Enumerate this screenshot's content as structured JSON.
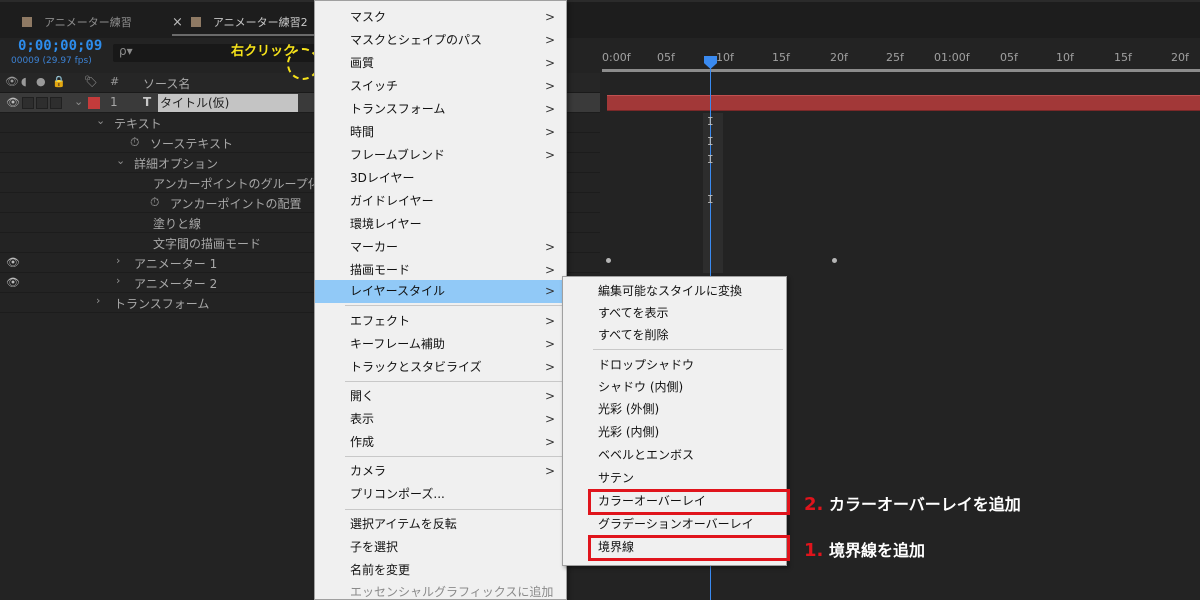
{
  "tabs": [
    {
      "label": "アニメーター練習",
      "active": false
    },
    {
      "label": "アニメーター練習2",
      "active": true,
      "close": "×"
    }
  ],
  "layer_panel": {
    "timecode": "0;00;00;09",
    "fps": "00009 (29.97 fps)",
    "search_placeholder": "ρ▾",
    "header": {
      "source_name": "ソース名",
      "hash": "#"
    },
    "layer": {
      "number": "1",
      "type_glyph": "T",
      "name": "タイトル(仮)"
    },
    "rows": [
      {
        "label": "テキスト",
        "chevron": "⌄"
      },
      {
        "label": "ソーステキスト",
        "stopwatch": "⏱"
      },
      {
        "label": "詳細オプション",
        "chevron": "⌄"
      },
      {
        "label": "アンカーポイントのグループ化"
      },
      {
        "label": "アンカーポイントの配置",
        "stopwatch": "⏱"
      },
      {
        "label": "塗りと線"
      },
      {
        "label": "文字間の描画モード"
      },
      {
        "label": "アニメーター 1",
        "chevron": "›"
      },
      {
        "label": "アニメーター 2",
        "chevron": "›"
      },
      {
        "label": "トランスフォーム",
        "chevron": "›"
      }
    ]
  },
  "annotation": {
    "right_click": "右クリック",
    "step1_num": "1.",
    "step1_text": "境界線を追加",
    "step2_num": "2.",
    "step2_text": "カラーオーバーレイを追加"
  },
  "timeline": {
    "ticks": [
      "0:00f",
      "05f",
      "10f",
      "15f",
      "20f",
      "25f",
      "01:00f",
      "05f",
      "10f",
      "15f",
      "20f"
    ],
    "keyframe_glyph": "I"
  },
  "context_menu": {
    "items": [
      {
        "label": "マスク",
        "submenu": true
      },
      {
        "label": "マスクとシェイプのパス",
        "submenu": true
      },
      {
        "label": "画質",
        "submenu": true
      },
      {
        "label": "スイッチ",
        "submenu": true
      },
      {
        "label": "トランスフォーム",
        "submenu": true
      },
      {
        "label": "時間",
        "submenu": true
      },
      {
        "label": "フレームブレンド",
        "submenu": true
      },
      {
        "label": "3Dレイヤー"
      },
      {
        "label": "ガイドレイヤー"
      },
      {
        "label": "環境レイヤー"
      },
      {
        "label": "マーカー",
        "submenu": true
      },
      {
        "label": "描画モード",
        "submenu": true
      },
      {
        "label": "レイヤースタイル",
        "submenu": true,
        "selected": true
      },
      {
        "label": "エフェクト",
        "submenu": true
      },
      {
        "label": "キーフレーム補助",
        "submenu": true
      },
      {
        "label": "トラックとスタビライズ",
        "submenu": true
      },
      {
        "label": "開く",
        "submenu": true
      },
      {
        "label": "表示",
        "submenu": true
      },
      {
        "label": "作成",
        "submenu": true
      },
      {
        "label": "カメラ",
        "submenu": true
      },
      {
        "label": "プリコンポーズ..."
      },
      {
        "label": "選択アイテムを反転"
      },
      {
        "label": "子を選択"
      },
      {
        "label": "名前を変更"
      },
      {
        "label": "エッセンシャルグラフィックスに追加",
        "disabled": true
      }
    ],
    "arrow": ">"
  },
  "layer_style_submenu": {
    "items": [
      {
        "label": "編集可能なスタイルに変換"
      },
      {
        "label": "すべてを表示"
      },
      {
        "label": "すべてを削除"
      },
      {
        "label": "ドロップシャドウ"
      },
      {
        "label": "シャドウ (内側)"
      },
      {
        "label": "光彩 (外側)"
      },
      {
        "label": "光彩 (内側)"
      },
      {
        "label": "ベベルとエンボス"
      },
      {
        "label": "サテン"
      },
      {
        "label": "カラーオーバーレイ",
        "highlighted": true
      },
      {
        "label": "グラデーションオーバーレイ"
      },
      {
        "label": "境界線",
        "highlighted": true
      }
    ]
  },
  "colors": {
    "accent_blue": "#2d8ceb",
    "layer_label_red": "#c43b3b",
    "highlight_red": "#e0141c",
    "annotation_yellow": "#f6e21a",
    "menu_selection": "#91c9f7"
  }
}
